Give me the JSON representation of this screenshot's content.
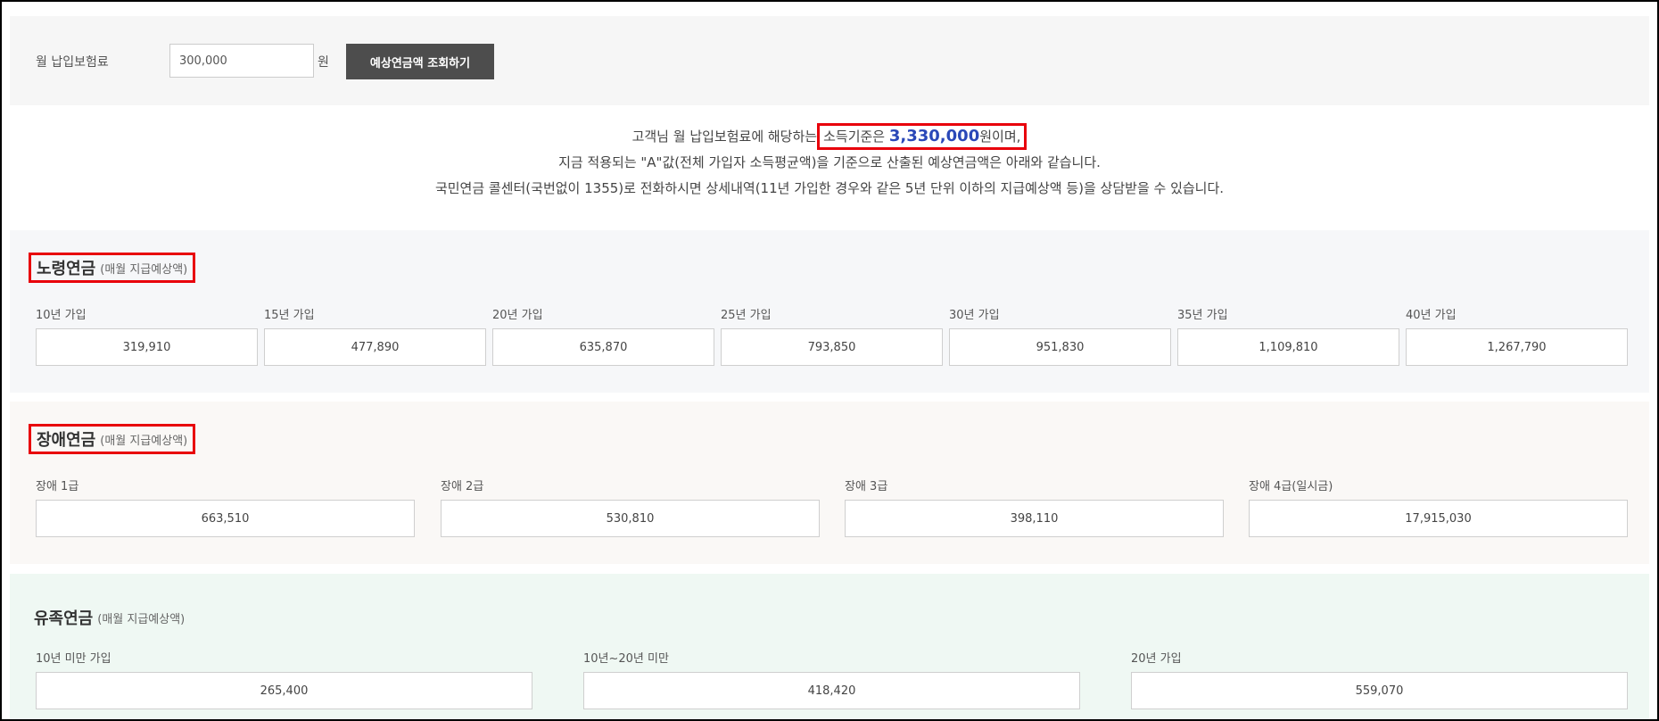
{
  "form": {
    "label": "월 납입보험료",
    "premium_value": "300,000",
    "unit": "원",
    "query_button": "예상연금액 조회하기"
  },
  "info": {
    "line1_pre": "고객님 월 납입보험료에 해당하는",
    "line1_hl_pre": "소득기준은 ",
    "income_amount": "3,330,000",
    "line1_hl_post": "원이며,",
    "line2": "지금 적용되는 \"A\"값(전체 가입자 소득평균액)을 기준으로 산출된 예상연금액은 아래와 같습니다.",
    "line3": "국민연금 콜센터(국번없이 1355)로 전화하시면 상세내역(11년 가입한 경우와 같은 5년 단위 이하의 지급예상액 등)을 상담받을 수 있습니다."
  },
  "old_age": {
    "title": "노령연금",
    "subtitle": "(매월 지급예상액)",
    "items": [
      {
        "label": "10년 가입",
        "value": "319,910"
      },
      {
        "label": "15년 가입",
        "value": "477,890"
      },
      {
        "label": "20년 가입",
        "value": "635,870"
      },
      {
        "label": "25년 가입",
        "value": "793,850"
      },
      {
        "label": "30년 가입",
        "value": "951,830"
      },
      {
        "label": "35년 가입",
        "value": "1,109,810"
      },
      {
        "label": "40년 가입",
        "value": "1,267,790"
      }
    ]
  },
  "disability": {
    "title": "장애연금",
    "subtitle": "(매월 지급예상액)",
    "items": [
      {
        "label": "장애 1급",
        "value": "663,510"
      },
      {
        "label": "장애 2급",
        "value": "530,810"
      },
      {
        "label": "장애 3급",
        "value": "398,110"
      },
      {
        "label": "장애 4급(일시금)",
        "value": "17,915,030"
      }
    ]
  },
  "survivor": {
    "title": "유족연금",
    "subtitle": "(매월 지급예상액)",
    "items": [
      {
        "label": "10년 미만 가입",
        "value": "265,400"
      },
      {
        "label": "10년~20년 미만",
        "value": "418,420"
      },
      {
        "label": "20년 가입",
        "value": "559,070"
      }
    ]
  },
  "colors": {
    "highlight_border": "#e8000b",
    "amount_text": "#2a48b8",
    "button_bg": "#4d4d4d"
  }
}
